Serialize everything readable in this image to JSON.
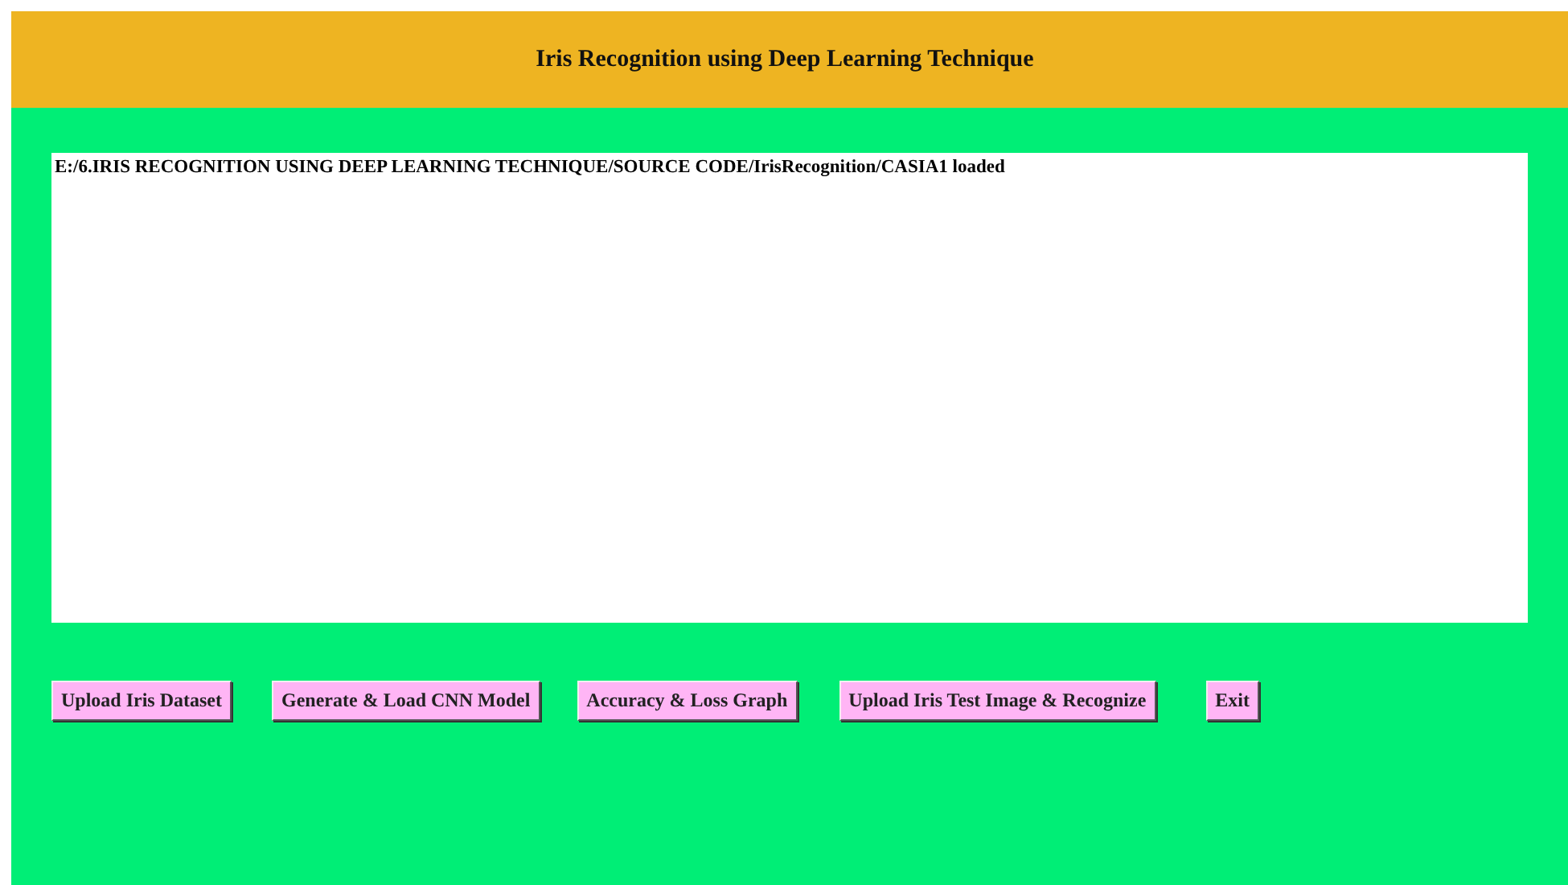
{
  "window": {
    "title": "Iris Recognition using Deep Learning Technique"
  },
  "output": {
    "lines": [
      "E:/6.IRIS RECOGNITION USING DEEP LEARNING TECHNIQUE/SOURCE CODE/IrisRecognition/CASIA1 loaded"
    ]
  },
  "buttons": [
    "Upload Iris Dataset",
    "Generate & Load CNN Model",
    "Accuracy & Loss Graph",
    "Upload Iris Test Image & Recognize",
    "Exit"
  ]
}
